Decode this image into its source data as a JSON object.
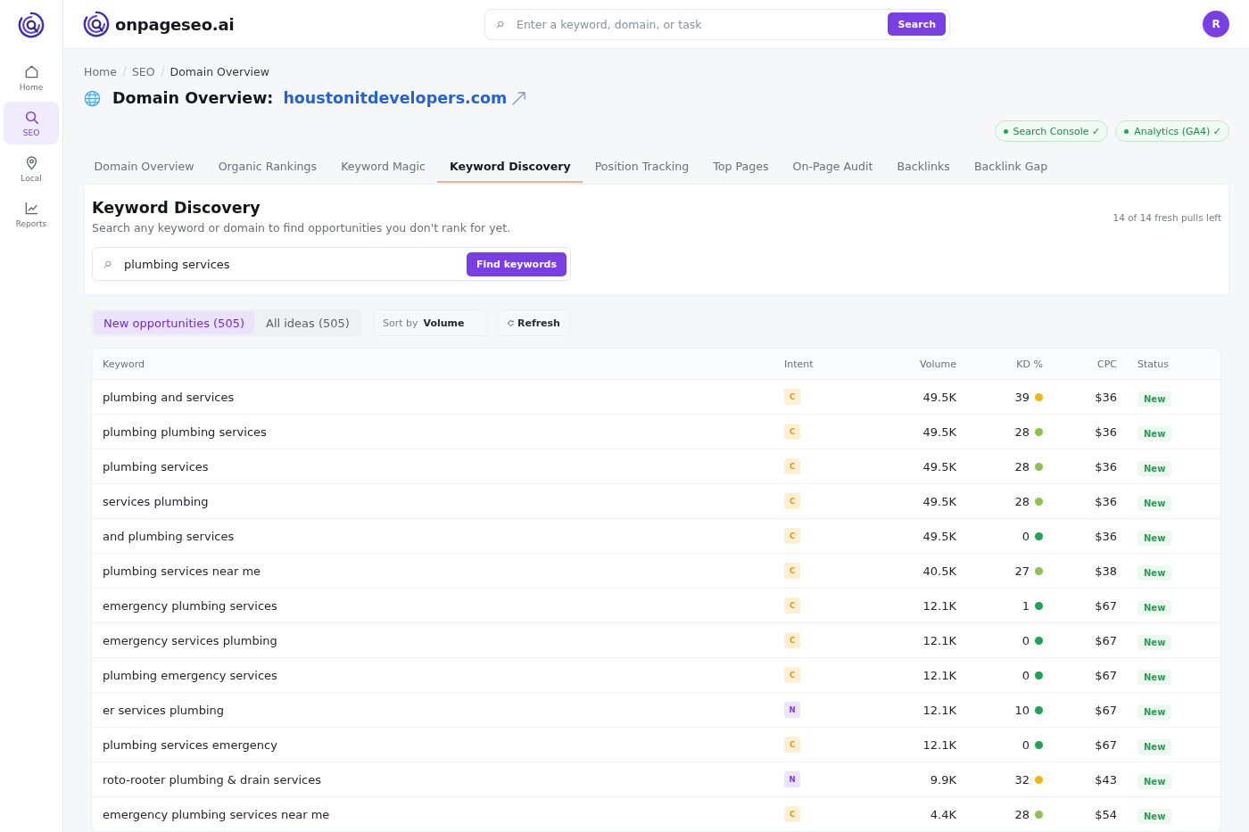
{
  "sidebar": {
    "items": [
      {
        "label": "Home",
        "selected": false
      },
      {
        "label": "SEO",
        "selected": true
      },
      {
        "label": "Local",
        "selected": false
      },
      {
        "label": "Reports",
        "selected": false
      }
    ]
  },
  "header": {
    "brand": "onpageseo.ai",
    "search": {
      "placeholder": "Enter a keyword, domain, or task",
      "button": "Search"
    },
    "avatar": "R"
  },
  "breadcrumb": [
    {
      "label": "Home",
      "current": false
    },
    {
      "label": "SEO",
      "current": false
    },
    {
      "label": "Domain Overview",
      "current": true
    }
  ],
  "page_title": {
    "label": "Domain Overview:",
    "domain": "houstonitdevelopers.com"
  },
  "integrations": [
    {
      "label": "Search Console ✓"
    },
    {
      "label": "Analytics (GA4) ✓"
    }
  ],
  "tabs": [
    {
      "label": "Domain Overview",
      "selected": false
    },
    {
      "label": "Organic Rankings",
      "selected": false
    },
    {
      "label": "Keyword Magic",
      "selected": false
    },
    {
      "label": "Keyword Discovery",
      "selected": true
    },
    {
      "label": "Position Tracking",
      "selected": false
    },
    {
      "label": "Top Pages",
      "selected": false
    },
    {
      "label": "On-Page Audit",
      "selected": false
    },
    {
      "label": "Backlinks",
      "selected": false
    },
    {
      "label": "Backlink Gap",
      "selected": false
    }
  ],
  "discovery": {
    "title": "Keyword Discovery",
    "subtitle": "Search any keyword or domain to find opportunities you don't rank for yet.",
    "quota": "14 of 14 fresh pulls left",
    "search": {
      "value": "plumbing services",
      "button": "Find keywords"
    }
  },
  "filters": {
    "views": [
      {
        "label": "New opportunities (505)",
        "selected": true
      },
      {
        "label": "All ideas (505)",
        "selected": false
      }
    ],
    "sort": {
      "label": "Sort by",
      "value": "Volume"
    },
    "refresh": "Refresh"
  },
  "table": {
    "columns": [
      "Keyword",
      "Intent",
      "Volume",
      "KD %",
      "CPC",
      "Status"
    ],
    "rows": [
      {
        "keyword": "plumbing and services",
        "intent": {
          "label": "C",
          "kind": "commercial"
        },
        "volume": "49.5K",
        "kd": {
          "value": "39",
          "color": "#f2b60f"
        },
        "cpc": "$36",
        "status": "New"
      },
      {
        "keyword": "plumbing plumbing services",
        "intent": {
          "label": "C",
          "kind": "commercial"
        },
        "volume": "49.5K",
        "kd": {
          "value": "28",
          "color": "#8cc350"
        },
        "cpc": "$36",
        "status": "New"
      },
      {
        "keyword": "plumbing services",
        "intent": {
          "label": "C",
          "kind": "commercial"
        },
        "volume": "49.5K",
        "kd": {
          "value": "28",
          "color": "#8cc350"
        },
        "cpc": "$36",
        "status": "New"
      },
      {
        "keyword": "services plumbing",
        "intent": {
          "label": "C",
          "kind": "commercial"
        },
        "volume": "49.5K",
        "kd": {
          "value": "28",
          "color": "#8cc350"
        },
        "cpc": "$36",
        "status": "New"
      },
      {
        "keyword": "and plumbing services",
        "intent": {
          "label": "C",
          "kind": "commercial"
        },
        "volume": "49.5K",
        "kd": {
          "value": "0",
          "color": "#1fa456"
        },
        "cpc": "$36",
        "status": "New"
      },
      {
        "keyword": "plumbing services near me",
        "intent": {
          "label": "C",
          "kind": "commercial"
        },
        "volume": "40.5K",
        "kd": {
          "value": "27",
          "color": "#8cc350"
        },
        "cpc": "$38",
        "status": "New"
      },
      {
        "keyword": "emergency plumbing services",
        "intent": {
          "label": "C",
          "kind": "commercial"
        },
        "volume": "12.1K",
        "kd": {
          "value": "1",
          "color": "#1fa456"
        },
        "cpc": "$67",
        "status": "New"
      },
      {
        "keyword": "emergency services plumbing",
        "intent": {
          "label": "C",
          "kind": "commercial"
        },
        "volume": "12.1K",
        "kd": {
          "value": "0",
          "color": "#1fa456"
        },
        "cpc": "$67",
        "status": "New"
      },
      {
        "keyword": "plumbing emergency services",
        "intent": {
          "label": "C",
          "kind": "commercial"
        },
        "volume": "12.1K",
        "kd": {
          "value": "0",
          "color": "#1fa456"
        },
        "cpc": "$67",
        "status": "New"
      },
      {
        "keyword": "er services plumbing",
        "intent": {
          "label": "N",
          "kind": "navigational"
        },
        "volume": "12.1K",
        "kd": {
          "value": "10",
          "color": "#1fa456"
        },
        "cpc": "$67",
        "status": "New"
      },
      {
        "keyword": "plumbing services emergency",
        "intent": {
          "label": "C",
          "kind": "commercial"
        },
        "volume": "12.1K",
        "kd": {
          "value": "0",
          "color": "#1fa456"
        },
        "cpc": "$67",
        "status": "New"
      },
      {
        "keyword": "roto-rooter plumbing & drain services",
        "intent": {
          "label": "N",
          "kind": "navigational"
        },
        "volume": "9.9K",
        "kd": {
          "value": "32",
          "color": "#f2b60f"
        },
        "cpc": "$43",
        "status": "New"
      },
      {
        "keyword": "emergency plumbing services near me",
        "intent": {
          "label": "C",
          "kind": "commercial"
        },
        "volume": "4.4K",
        "kd": {
          "value": "28",
          "color": "#8cc350"
        },
        "cpc": "$54",
        "status": "New"
      }
    ]
  }
}
